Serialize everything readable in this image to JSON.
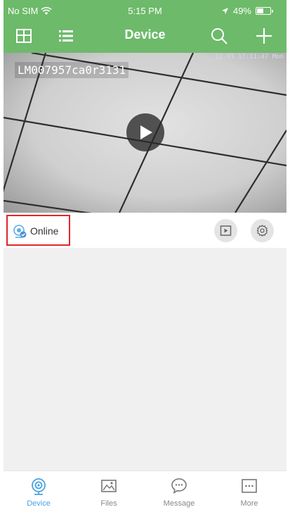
{
  "status_bar": {
    "carrier": "No SIM",
    "time": "5:15 PM",
    "battery": "49%",
    "battery_level": 0.49
  },
  "nav": {
    "title": "Device",
    "left_icons": [
      "grid-icon",
      "list-icon"
    ],
    "right_icons": [
      "search-icon",
      "plus-icon"
    ]
  },
  "camera": {
    "name": "LM007957ca0r3131",
    "timestamp": "12-03 17:11:47 Mon"
  },
  "device_status": {
    "label": "Online",
    "actions": [
      "playback-icon",
      "settings-icon"
    ]
  },
  "tabs": [
    {
      "label": "Device",
      "icon": "webcam-icon",
      "active": true
    },
    {
      "label": "Files",
      "icon": "image-icon",
      "active": false
    },
    {
      "label": "Message",
      "icon": "chat-icon",
      "active": false
    },
    {
      "label": "More",
      "icon": "more-icon",
      "active": false
    }
  ],
  "colors": {
    "header": "#6dba6a",
    "active_tab": "#4aa3df",
    "highlight_box": "#e0262c"
  }
}
